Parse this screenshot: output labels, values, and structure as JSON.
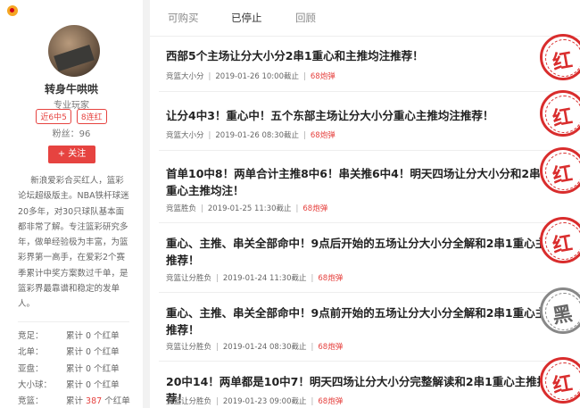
{
  "profile": {
    "name": "转身牛哄哄",
    "level": "专业玩家",
    "badges": [
      "近6中5",
      "8连红"
    ],
    "fans": "粉丝：96",
    "follow_label": "+ 关注",
    "bio": "新浪爱彩合买红人，篮彩论坛超级版主。NBA铁杆球迷20多年，对30只球队基本面都非常了解。专注篮彩研究多年，做单经验极为丰富，为篮彩界第一高手，在爱彩2个赛季累计中奖方案数过千单，是篮彩界最靠谱和稳定的发单人。",
    "stats": [
      {
        "key": "竞足：",
        "prefix": "累计 ",
        "value": "0",
        "suffix": " 个红单"
      },
      {
        "key": "北单：",
        "prefix": "累计 ",
        "value": "0",
        "suffix": " 个红单"
      },
      {
        "key": "亚盘：",
        "prefix": "累计 ",
        "value": "0",
        "suffix": " 个红单"
      },
      {
        "key": "大小球：",
        "prefix": "累计 ",
        "value": "0",
        "suffix": " 个红单"
      },
      {
        "key": "竞篮：",
        "prefix": "累计 ",
        "value": "387",
        "suffix": " 个红单"
      }
    ]
  },
  "tabs": [
    "可购买",
    "已停止",
    "回顾"
  ],
  "active_tab": "已停止",
  "articles": [
    {
      "title": "西部5个主场让分大小分2串1重心和主推均注推荐！",
      "category": "竞篮大小分",
      "date": "2019-01-26 10:00截止",
      "hot": "68炮弹",
      "stamp": "红"
    },
    {
      "title": "让分4中3！重心中！五个东部主场让分大小分重心主推均注推荐！",
      "category": "竞篮大小分",
      "date": "2019-01-26 08:30截止",
      "hot": "68炮弹",
      "stamp": "红"
    },
    {
      "title": "首单10中8！两单合计主推8中6！串关推6中4！明天四场让分大小分和2串1重心主推均注！",
      "category": "竞篮胜负",
      "date": "2019-01-25 11:30截止",
      "hot": "68炮弹",
      "stamp": "红"
    },
    {
      "title": "重心、主推、串关全部命中！9点后开始的五场让分大小分全解和2串1重心主推推荐！",
      "category": "竞篮让分胜负",
      "date": "2019-01-24 11:30截止",
      "hot": "68炮弹",
      "stamp": "红"
    },
    {
      "title": "重心、主推、串关全部命中！9点前开始的五场让分大小分全解和2串1重心主推推荐！",
      "category": "竞篮让分胜负",
      "date": "2019-01-24 08:30截止",
      "hot": "68炮弹",
      "stamp": "黑"
    },
    {
      "title": "20中14！两单都是10中7！明天四场让分大小分完整解读和2串1重心主推推荐！",
      "category": "竞篮让分胜负",
      "date": "2019-01-23 09:00截止",
      "hot": "68炮弹",
      "stamp": "红"
    }
  ],
  "colors": {
    "accent": "#e64340",
    "stamp_red": "#d92d2d",
    "stamp_grey": "#888888"
  }
}
